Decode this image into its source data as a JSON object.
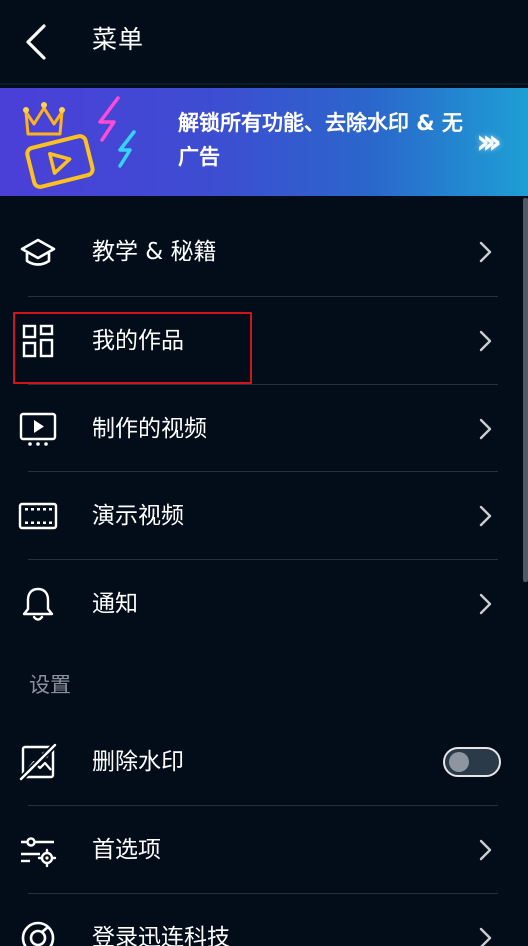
{
  "header": {
    "title": "菜单",
    "back_icon": "chevron-left-icon"
  },
  "banner": {
    "text": "解锁所有功能、去除水印 & 无广告",
    "arrows": "›››",
    "art_icon": "crown-video-neon-icon",
    "colors": {
      "start": "#4b3fd8",
      "end": "#1d9fd4"
    }
  },
  "menu": {
    "items": [
      {
        "label": "教学 & 秘籍",
        "icon": "graduation-cap-icon"
      },
      {
        "label": "我的作品",
        "icon": "grid-icon"
      },
      {
        "label": "制作的视频",
        "icon": "video-play-icon"
      },
      {
        "label": "演示视频",
        "icon": "film-strip-icon"
      },
      {
        "label": "通知",
        "icon": "bell-icon"
      }
    ]
  },
  "settings": {
    "section_label": "设置",
    "items": [
      {
        "label": "删除水印",
        "icon": "no-image-icon",
        "toggle": false
      },
      {
        "label": "首选项",
        "icon": "sliders-gear-icon"
      },
      {
        "label": "登录迅连科技",
        "icon": "account-circle-icon"
      }
    ]
  },
  "colors": {
    "background": "#030d1a",
    "divider": "#25313f",
    "highlight": "#d0141a",
    "section_text": "#8b939c"
  }
}
